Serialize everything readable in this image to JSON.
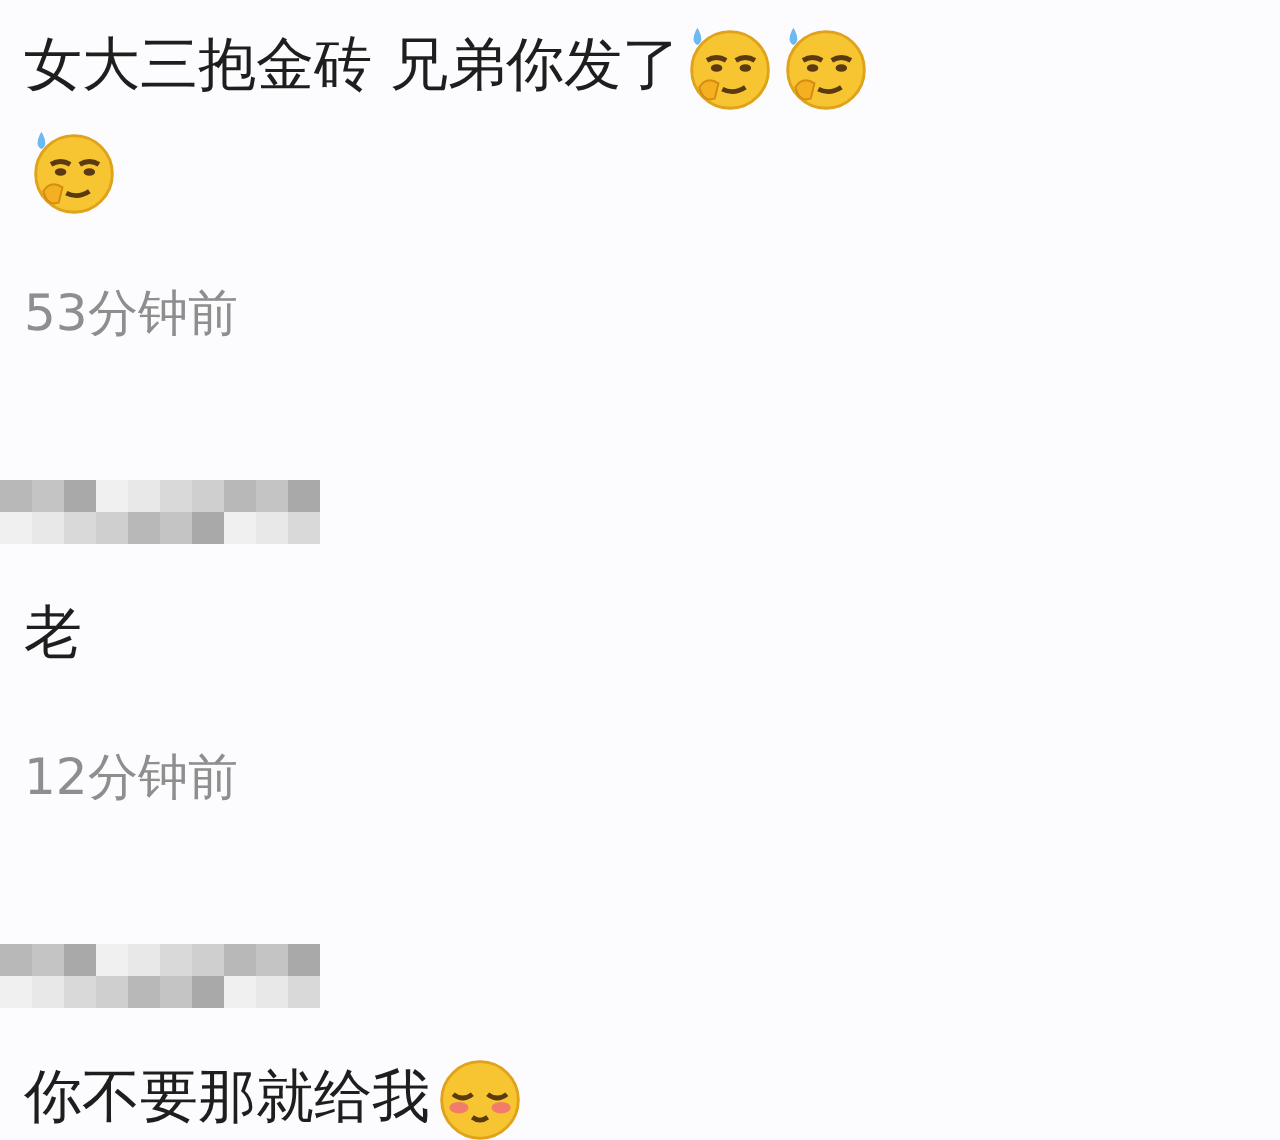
{
  "comments": [
    {
      "text": "女大三抱金砖 兄弟你发了",
      "emojis": [
        {
          "kind": "smirk"
        },
        {
          "kind": "smirk"
        },
        {
          "kind": "smirk"
        }
      ],
      "time": "53分钟前"
    },
    {
      "author_blurred": true,
      "text": "老",
      "time": "12分钟前"
    },
    {
      "author_blurred": true,
      "text": "你不要那就给我",
      "emojis": [
        {
          "kind": "blush"
        }
      ]
    }
  ]
}
